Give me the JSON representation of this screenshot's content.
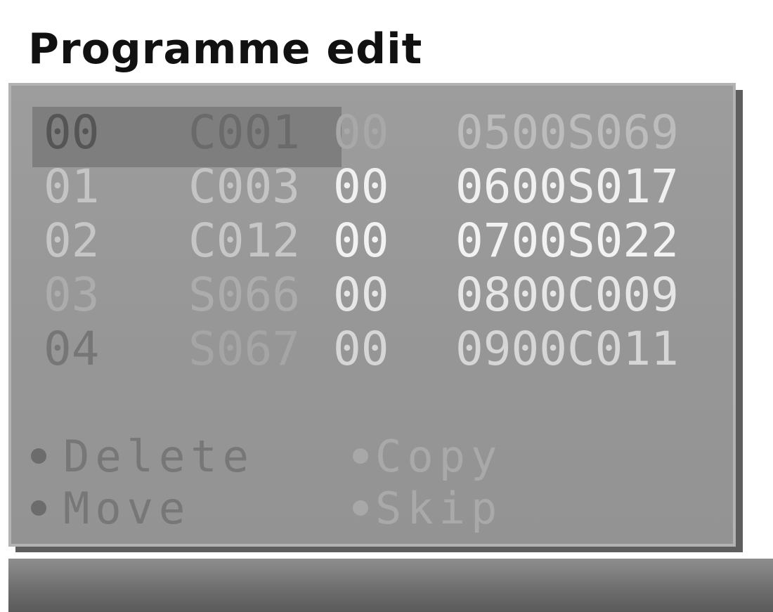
{
  "header": {
    "title": "Programme edit"
  },
  "programme_list": {
    "selected_index": 0,
    "rows": [
      {
        "num": "00",
        "channel": "C001",
        "time1": "00",
        "time2": "0500S069"
      },
      {
        "num": "01",
        "channel": "C003",
        "time1": "00",
        "time2": "0600S017"
      },
      {
        "num": "02",
        "channel": "C012",
        "time1": "00",
        "time2": "0700S022"
      },
      {
        "num": "03",
        "channel": "S066",
        "time1": "00",
        "time2": "0800C009"
      },
      {
        "num": "04",
        "channel": "S067",
        "time1": "00",
        "time2": "0900C011"
      }
    ]
  },
  "actions": [
    {
      "left_label": "Delete",
      "right_label": "Copy"
    },
    {
      "left_label": "Move",
      "right_label": "Skip"
    }
  ],
  "colors": {
    "panel": "#9a9a9a",
    "panel_shadow": "#5e5e5e",
    "cursor": "#7e7e7e",
    "bottom_bar": "#6f6f6f"
  }
}
